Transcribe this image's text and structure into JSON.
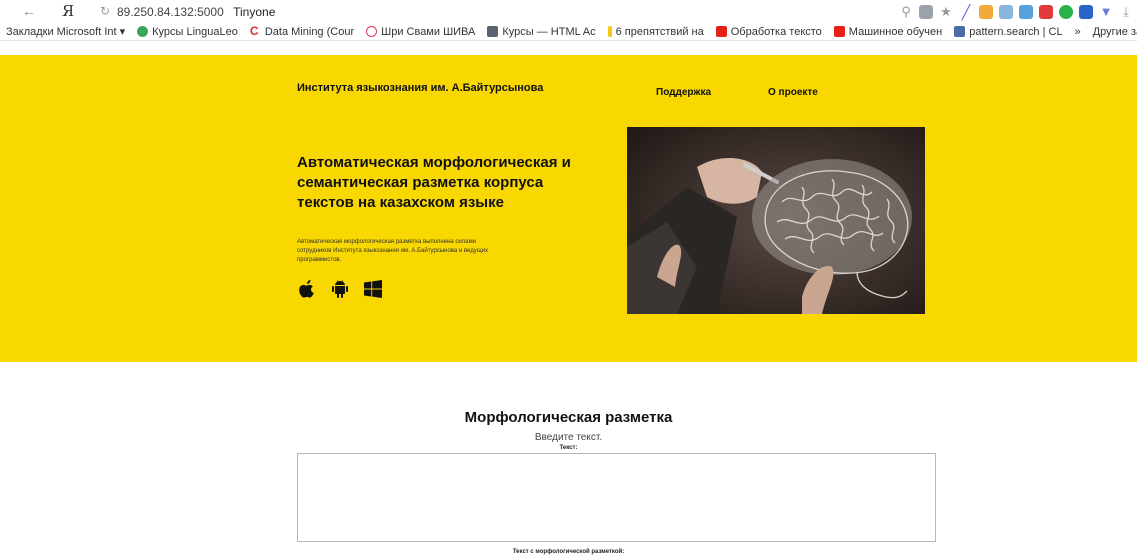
{
  "browser": {
    "address": {
      "host": "89.250.84.132:5000",
      "title": "Tinyone"
    },
    "bookmarks": [
      {
        "label": "Закладки Microsoft Int",
        "faded": false,
        "icon": ""
      },
      {
        "label": "Курсы LinguaLeo",
        "faded": false,
        "icon": "#3aa65a"
      },
      {
        "label": "Data Mining (Cour",
        "faded": false,
        "icon": "#e0302a"
      },
      {
        "label": "Шри Свами ШИВА",
        "faded": false,
        "icon": "#d83a5a"
      },
      {
        "label": "Курсы — HTML Ac",
        "faded": false,
        "icon": "#5a6270"
      },
      {
        "label": "6 препятствий на",
        "faded": false,
        "icon": "#f5c518"
      },
      {
        "label": "Обработка тексто",
        "faded": false,
        "icon": "#e62117"
      },
      {
        "label": "Машинное обучен",
        "faded": false,
        "icon": "#e62117"
      },
      {
        "label": "pattern.search | CL",
        "faded": false,
        "icon": "#4a6aa8"
      },
      {
        "label": "»",
        "faded": false,
        "icon": ""
      },
      {
        "label": "Другие закладки",
        "faded": false,
        "icon": ""
      }
    ]
  },
  "header": {
    "brand": "Института языкознания им. А.Байтурсынова",
    "nav": {
      "support": "Поддержка",
      "about": "О проекте"
    }
  },
  "hero": {
    "title": "Автоматическая морфологическая и семантическая разметка корпуса текстов на казахском языке",
    "description": "Автоматическая морфологическая разметка выполнена силами сотрудников Института языкознания им. А.Байтурсынова и ведущих программистов.",
    "platforms": [
      "apple-icon",
      "android-icon",
      "windows-icon"
    ]
  },
  "main": {
    "section_title": "Морфологическая разметка",
    "prompt": "Введите текст.",
    "text_label": "Текст:",
    "result_label": "Текст с морфологической разметкой:"
  },
  "colors": {
    "hero_bg": "#f8d800"
  }
}
